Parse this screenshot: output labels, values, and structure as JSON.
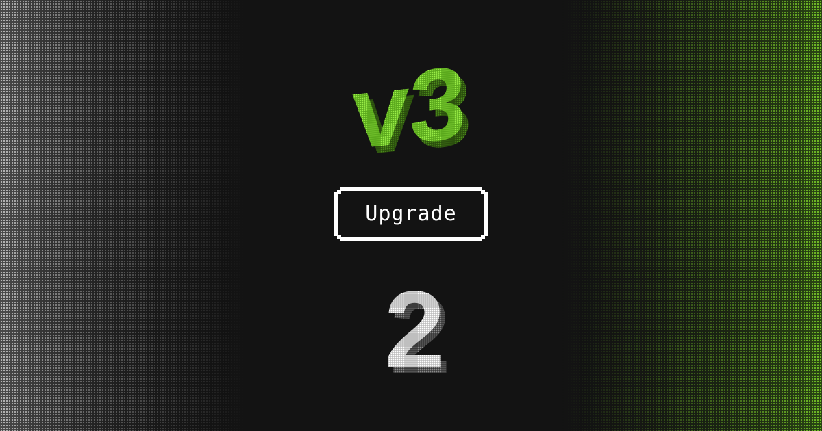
{
  "hero": {
    "from_version": "v3",
    "cta_label": "Upgrade",
    "to_version": "2"
  },
  "colors": {
    "background": "#131313",
    "accent_green": "#7cdc2a",
    "accent_green_dark": "#3a6a12",
    "text_white": "#ffffff",
    "left_gradient": "#8a8a8a",
    "right_gradient": "#6fbf2a"
  }
}
